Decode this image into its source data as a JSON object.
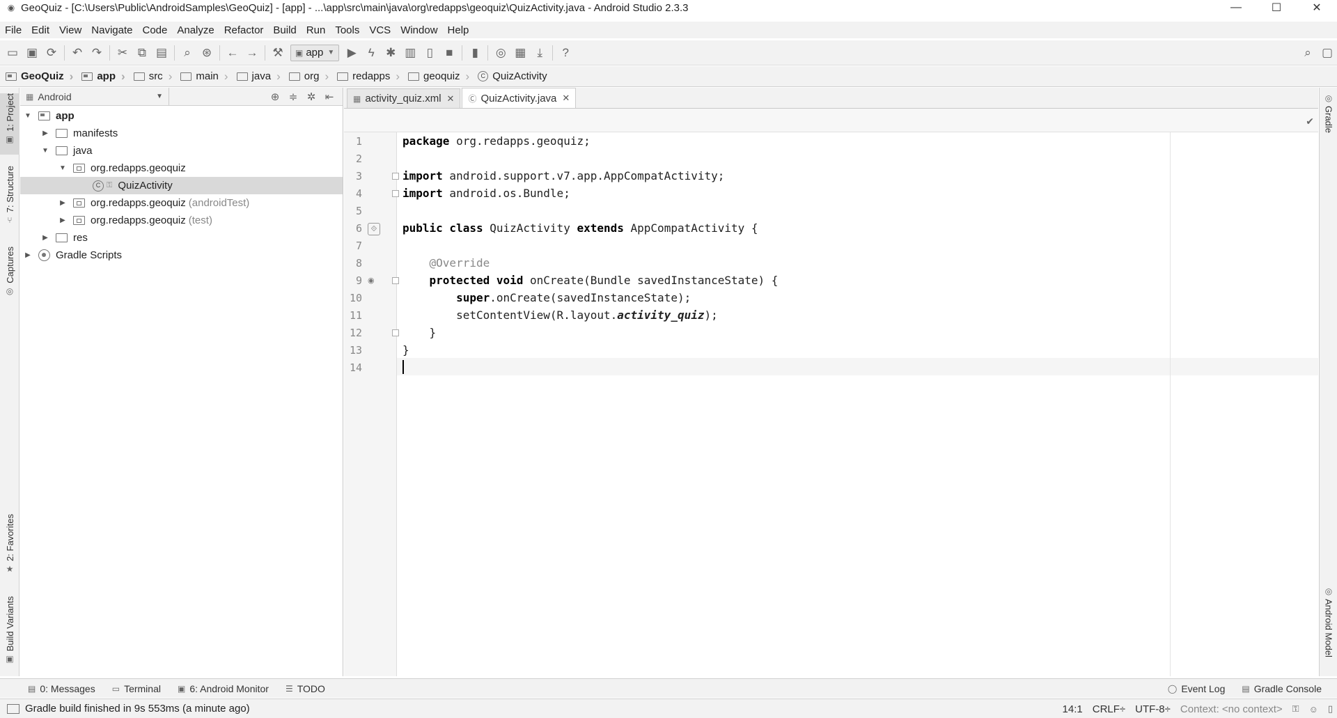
{
  "window": {
    "title": "GeoQuiz - [C:\\Users\\Public\\AndroidSamples\\GeoQuiz] - [app] - ...\\app\\src\\main\\java\\org\\redapps\\geoquiz\\QuizActivity.java - Android Studio 2.3.3",
    "minimize": "—",
    "maximize": "☐",
    "close": "✕"
  },
  "menu": [
    "File",
    "Edit",
    "View",
    "Navigate",
    "Code",
    "Analyze",
    "Refactor",
    "Build",
    "Run",
    "Tools",
    "VCS",
    "Window",
    "Help"
  ],
  "toolbar": {
    "run_config": "app"
  },
  "breadcrumbs": [
    "GeoQuiz",
    "app",
    "src",
    "main",
    "java",
    "org",
    "redapps",
    "geoquiz",
    "QuizActivity"
  ],
  "left_tool_tabs": {
    "project": "1: Project",
    "structure": "7: Structure",
    "captures": "Captures",
    "favorites": "2: Favorites",
    "build_variants": "Build Variants"
  },
  "right_tool_tabs": {
    "gradle": "Gradle",
    "android_model": "Android Model"
  },
  "project_panel": {
    "view": "Android",
    "tree": [
      {
        "label": "app",
        "suffix": "",
        "depth": 0,
        "expanded": true
      },
      {
        "label": "manifests",
        "suffix": "",
        "depth": 1,
        "expanded": false
      },
      {
        "label": "java",
        "suffix": "",
        "depth": 1,
        "expanded": true
      },
      {
        "label": "org.redapps.geoquiz",
        "suffix": "",
        "depth": 2,
        "expanded": true
      },
      {
        "label": "QuizActivity",
        "suffix": "",
        "depth": 3,
        "selected": true
      },
      {
        "label": "org.redapps.geoquiz",
        "suffix": "(androidTest)",
        "depth": 2,
        "expanded": false
      },
      {
        "label": "org.redapps.geoquiz",
        "suffix": "(test)",
        "depth": 2,
        "expanded": false
      },
      {
        "label": "res",
        "suffix": "",
        "depth": 1,
        "expanded": false
      },
      {
        "label": "Gradle Scripts",
        "suffix": "",
        "depth": 0,
        "expanded": false
      }
    ]
  },
  "editor": {
    "tabs": [
      {
        "label": "activity_quiz.xml",
        "active": false
      },
      {
        "label": "QuizActivity.java",
        "active": true
      }
    ],
    "lines": [
      "package org.redapps.geoquiz;",
      "",
      "import android.support.v7.app.AppCompatActivity;",
      "import android.os.Bundle;",
      "",
      "public class QuizActivity extends AppCompatActivity {",
      "",
      "    @Override",
      "    protected void onCreate(Bundle savedInstanceState) {",
      "        super.onCreate(savedInstanceState);",
      "        setContentView(R.layout.activity_quiz);",
      "    }",
      "}",
      ""
    ],
    "current_line": 14
  },
  "bottom_tabs": {
    "messages": "0: Messages",
    "terminal": "Terminal",
    "android_monitor": "6: Android Monitor",
    "todo": "TODO",
    "event_log": "Event Log",
    "gradle_console": "Gradle Console"
  },
  "status": {
    "message": "Gradle build finished in 9s 553ms (a minute ago)",
    "position": "14:1",
    "line_sep": "CRLF÷",
    "encoding": "UTF-8÷",
    "context": "Context: <no context>"
  }
}
